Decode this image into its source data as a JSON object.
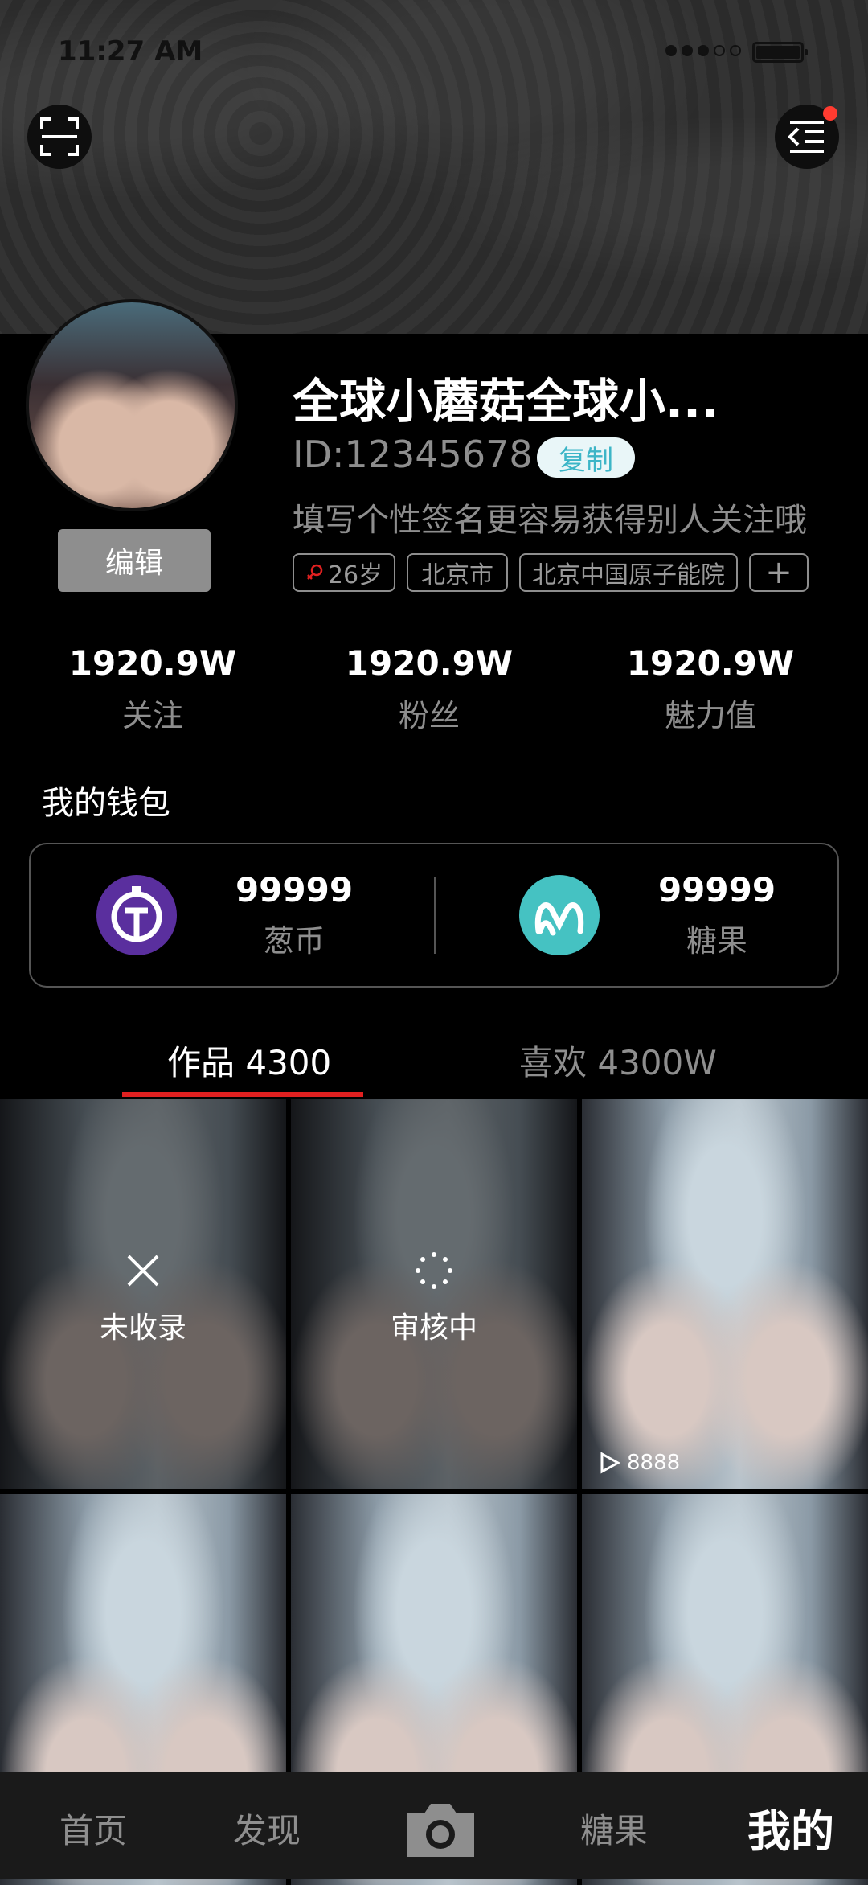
{
  "status_bar": {
    "time": "11:27 AM"
  },
  "profile": {
    "nickname": "全球小蘑菇全球小...",
    "id": "ID:12345678",
    "copy_label": "复制",
    "bio": "填写个性签名更容易获得别人关注哦",
    "edit_label": "编辑",
    "tags": {
      "age": "26岁",
      "city": "北京市",
      "school": "北京中国原子能院",
      "add": "+"
    }
  },
  "stats": [
    {
      "value": "1920.9W",
      "label": "关注"
    },
    {
      "value": "1920.9W",
      "label": "粉丝"
    },
    {
      "value": "1920.9W",
      "label": "魅力值"
    }
  ],
  "wallet": {
    "title": "我的钱包",
    "cong": {
      "value": "99999",
      "label": "葱币",
      "icon": "cong-coin-icon",
      "color": "#5a2f9e"
    },
    "candy": {
      "value": "99999",
      "label": "糖果",
      "icon": "candy-icon",
      "color": "#45c2c2"
    }
  },
  "tabs": {
    "works": "作品 4300",
    "likes": "喜欢 4300W",
    "active": "works",
    "indicator_color": "#e02020"
  },
  "grid": {
    "items": [
      {
        "status": "未收录",
        "icon": "close-icon"
      },
      {
        "status": "审核中",
        "icon": "loading-icon"
      },
      {
        "play_count": "8888",
        "icon": "play-icon"
      },
      {},
      {},
      {}
    ]
  },
  "bottom_nav": {
    "home": "首页",
    "discover": "发现",
    "camera_icon": "camera-icon",
    "candy": "糖果",
    "mine": "我的",
    "active": "mine"
  }
}
